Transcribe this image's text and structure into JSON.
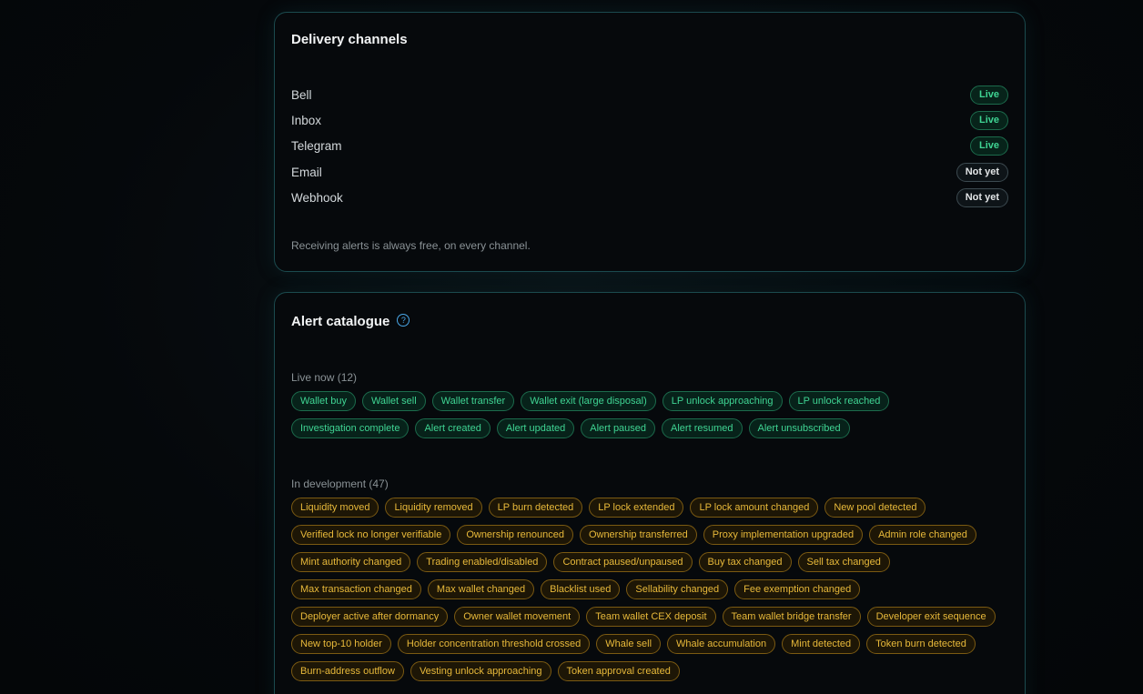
{
  "delivery": {
    "title": "Delivery channels",
    "channels": [
      {
        "name": "Bell",
        "status": "Live"
      },
      {
        "name": "Inbox",
        "status": "Live"
      },
      {
        "name": "Telegram",
        "status": "Live"
      },
      {
        "name": "Email",
        "status": "Not yet"
      },
      {
        "name": "Webhook",
        "status": "Not yet"
      }
    ],
    "footnote": "Receiving alerts is always free, on every channel."
  },
  "catalogue": {
    "title": "Alert catalogue",
    "help_icon": "question-circle-icon",
    "live": {
      "label": "Live now (12)",
      "items": [
        "Wallet buy",
        "Wallet sell",
        "Wallet transfer",
        "Wallet exit (large disposal)",
        "LP unlock approaching",
        "LP unlock reached",
        "Investigation complete",
        "Alert created",
        "Alert updated",
        "Alert paused",
        "Alert resumed",
        "Alert unsubscribed"
      ]
    },
    "development": {
      "label": "In development (47)",
      "items": [
        "Liquidity moved",
        "Liquidity removed",
        "LP burn detected",
        "LP lock extended",
        "LP lock amount changed",
        "New pool detected",
        "Verified lock no longer verifiable",
        "Ownership renounced",
        "Ownership transferred",
        "Proxy implementation upgraded",
        "Admin role changed",
        "Mint authority changed",
        "Trading enabled/disabled",
        "Contract paused/unpaused",
        "Buy tax changed",
        "Sell tax changed",
        "Max transaction changed",
        "Max wallet changed",
        "Blacklist used",
        "Sellability changed",
        "Fee exemption changed",
        "Deployer active after dormancy",
        "Owner wallet movement",
        "Team wallet CEX deposit",
        "Team wallet bridge transfer",
        "Developer exit sequence",
        "New top-10 holder",
        "Holder concentration threshold crossed",
        "Whale sell",
        "Whale accumulation",
        "Mint detected",
        "Token burn detected",
        "Burn-address outflow",
        "Vesting unlock approaching",
        "Token approval created"
      ]
    }
  },
  "colors": {
    "live_green": "#3fd493",
    "dev_amber": "#e8b93a",
    "card_border": "#1b4a4e",
    "help_blue": "#4aa7e8"
  }
}
